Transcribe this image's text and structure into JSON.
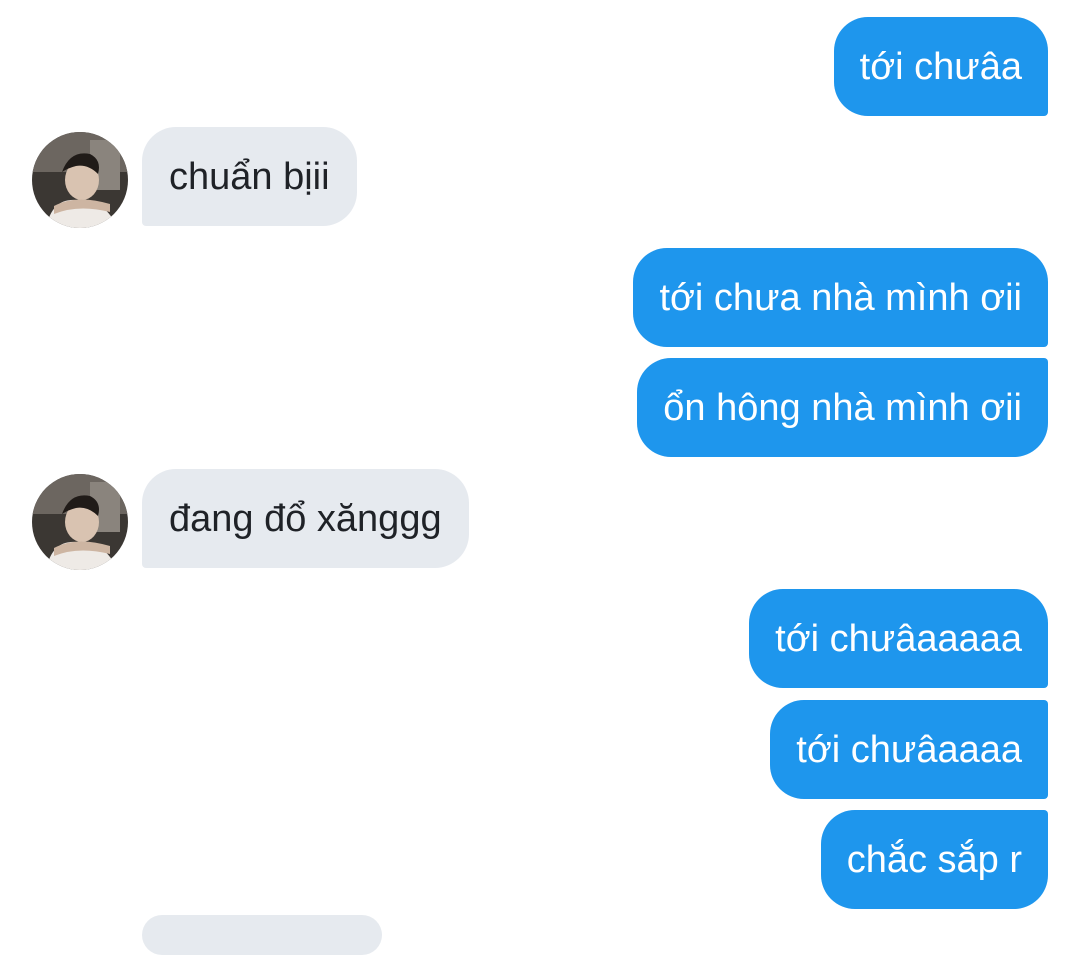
{
  "conversation": {
    "messages": [
      {
        "direction": "outgoing",
        "text": "tới chưâa"
      },
      {
        "direction": "incoming",
        "text": "chuẩn bịii"
      },
      {
        "direction": "outgoing",
        "text": "tới chưa nhà mình ơii"
      },
      {
        "direction": "outgoing",
        "text": "ổn hông nhà mình ơii"
      },
      {
        "direction": "incoming",
        "text": "đang đổ xănggg"
      },
      {
        "direction": "outgoing",
        "text": "tới chưâaaaaa"
      },
      {
        "direction": "outgoing",
        "text": "tới chưâaaaa"
      },
      {
        "direction": "outgoing",
        "text": "chắc sắp r"
      }
    ]
  },
  "colors": {
    "outgoing_bubble": "#1e96ed",
    "incoming_bubble": "#e6eaef",
    "outgoing_text": "#ffffff",
    "incoming_text": "#1f2227"
  },
  "icons": {
    "contact_avatar": "avatar-photo"
  }
}
